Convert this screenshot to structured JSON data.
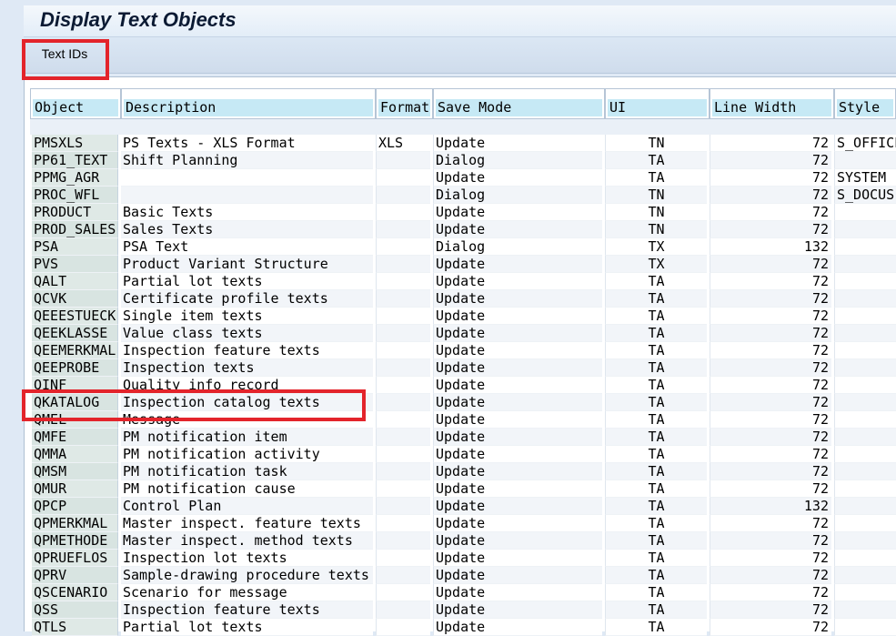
{
  "window": {
    "title": "Display Text Objects"
  },
  "toolbar": {
    "text_ids_label": "Text IDs"
  },
  "columns": {
    "object": "Object",
    "description": "Description",
    "format": "Format",
    "save_mode": "Save Mode",
    "ui": "UI",
    "line_width": "Line Width",
    "style": "Style"
  },
  "rows": [
    {
      "object": "PMSXLS",
      "description": "PS Texts - XLS Format",
      "format": "XLS",
      "save_mode": "Update",
      "ui": "TN",
      "line_width": "72",
      "style": "S_OFFICE"
    },
    {
      "object": "PP61_TEXT",
      "description": "Shift Planning",
      "format": "",
      "save_mode": "Dialog",
      "ui": "TA",
      "line_width": "72",
      "style": ""
    },
    {
      "object": "PPMG_AGR",
      "description": "",
      "format": "",
      "save_mode": "Update",
      "ui": "TA",
      "line_width": "72",
      "style": "SYSTEM"
    },
    {
      "object": "PROC_WFL",
      "description": "",
      "format": "",
      "save_mode": "Dialog",
      "ui": "TN",
      "line_width": "72",
      "style": "S_DOCUS"
    },
    {
      "object": "PRODUCT",
      "description": "Basic Texts",
      "format": "",
      "save_mode": "Update",
      "ui": "TN",
      "line_width": "72",
      "style": ""
    },
    {
      "object": "PROD_SALES",
      "description": "Sales Texts",
      "format": "",
      "save_mode": "Update",
      "ui": "TN",
      "line_width": "72",
      "style": ""
    },
    {
      "object": "PSA",
      "description": "PSA Text",
      "format": "",
      "save_mode": "Dialog",
      "ui": "TX",
      "line_width": "132",
      "style": ""
    },
    {
      "object": "PVS",
      "description": "Product Variant Structure",
      "format": "",
      "save_mode": "Update",
      "ui": "TX",
      "line_width": "72",
      "style": ""
    },
    {
      "object": "QALT",
      "description": "Partial lot texts",
      "format": "",
      "save_mode": "Update",
      "ui": "TA",
      "line_width": "72",
      "style": ""
    },
    {
      "object": "QCVK",
      "description": "Certificate profile texts",
      "format": "",
      "save_mode": "Update",
      "ui": "TA",
      "line_width": "72",
      "style": ""
    },
    {
      "object": "QEEESTUECK",
      "description": "Single item texts",
      "format": "",
      "save_mode": "Update",
      "ui": "TA",
      "line_width": "72",
      "style": ""
    },
    {
      "object": "QEEKLASSE",
      "description": "Value class texts",
      "format": "",
      "save_mode": "Update",
      "ui": "TA",
      "line_width": "72",
      "style": ""
    },
    {
      "object": "QEEMERKMAL",
      "description": "Inspection feature texts",
      "format": "",
      "save_mode": "Update",
      "ui": "TA",
      "line_width": "72",
      "style": ""
    },
    {
      "object": "QEEPROBE",
      "description": "Inspection texts",
      "format": "",
      "save_mode": "Update",
      "ui": "TA",
      "line_width": "72",
      "style": ""
    },
    {
      "object": "QINF",
      "description": "Quality info record",
      "format": "",
      "save_mode": "Update",
      "ui": "TA",
      "line_width": "72",
      "style": ""
    },
    {
      "object": "QKATALOG",
      "description": "Inspection catalog texts",
      "format": "",
      "save_mode": "Update",
      "ui": "TA",
      "line_width": "72",
      "style": ""
    },
    {
      "object": "QMEL",
      "description": "Message",
      "format": "",
      "save_mode": "Update",
      "ui": "TA",
      "line_width": "72",
      "style": ""
    },
    {
      "object": "QMFE",
      "description": "PM notification item",
      "format": "",
      "save_mode": "Update",
      "ui": "TA",
      "line_width": "72",
      "style": ""
    },
    {
      "object": "QMMA",
      "description": "PM notification activity",
      "format": "",
      "save_mode": "Update",
      "ui": "TA",
      "line_width": "72",
      "style": ""
    },
    {
      "object": "QMSM",
      "description": "PM notification task",
      "format": "",
      "save_mode": "Update",
      "ui": "TA",
      "line_width": "72",
      "style": ""
    },
    {
      "object": "QMUR",
      "description": "PM notification cause",
      "format": "",
      "save_mode": "Update",
      "ui": "TA",
      "line_width": "72",
      "style": ""
    },
    {
      "object": "QPCP",
      "description": "Control Plan",
      "format": "",
      "save_mode": "Update",
      "ui": "TA",
      "line_width": "132",
      "style": ""
    },
    {
      "object": "QPMERKMAL",
      "description": "Master inspect. feature texts",
      "format": "",
      "save_mode": "Update",
      "ui": "TA",
      "line_width": "72",
      "style": ""
    },
    {
      "object": "QPMETHODE",
      "description": "Master inspect. method texts",
      "format": "",
      "save_mode": "Update",
      "ui": "TA",
      "line_width": "72",
      "style": ""
    },
    {
      "object": "QPRUEFLOS",
      "description": "Inspection lot texts",
      "format": "",
      "save_mode": "Update",
      "ui": "TA",
      "line_width": "72",
      "style": ""
    },
    {
      "object": "QPRV",
      "description": "Sample-drawing procedure texts",
      "format": "",
      "save_mode": "Update",
      "ui": "TA",
      "line_width": "72",
      "style": ""
    },
    {
      "object": "QSCENARIO",
      "description": "Scenario for message",
      "format": "",
      "save_mode": "Update",
      "ui": "TA",
      "line_width": "72",
      "style": ""
    },
    {
      "object": "QSS",
      "description": "Inspection feature texts",
      "format": "",
      "save_mode": "Update",
      "ui": "TA",
      "line_width": "72",
      "style": ""
    },
    {
      "object": "QTLS",
      "description": "Partial lot texts",
      "format": "",
      "save_mode": "Update",
      "ui": "TA",
      "line_width": "72",
      "style": ""
    }
  ],
  "colors": {
    "highlight": "#e3242b",
    "header_bg": "#c6e9f5",
    "object_col_bg": "#dfe9e6"
  }
}
